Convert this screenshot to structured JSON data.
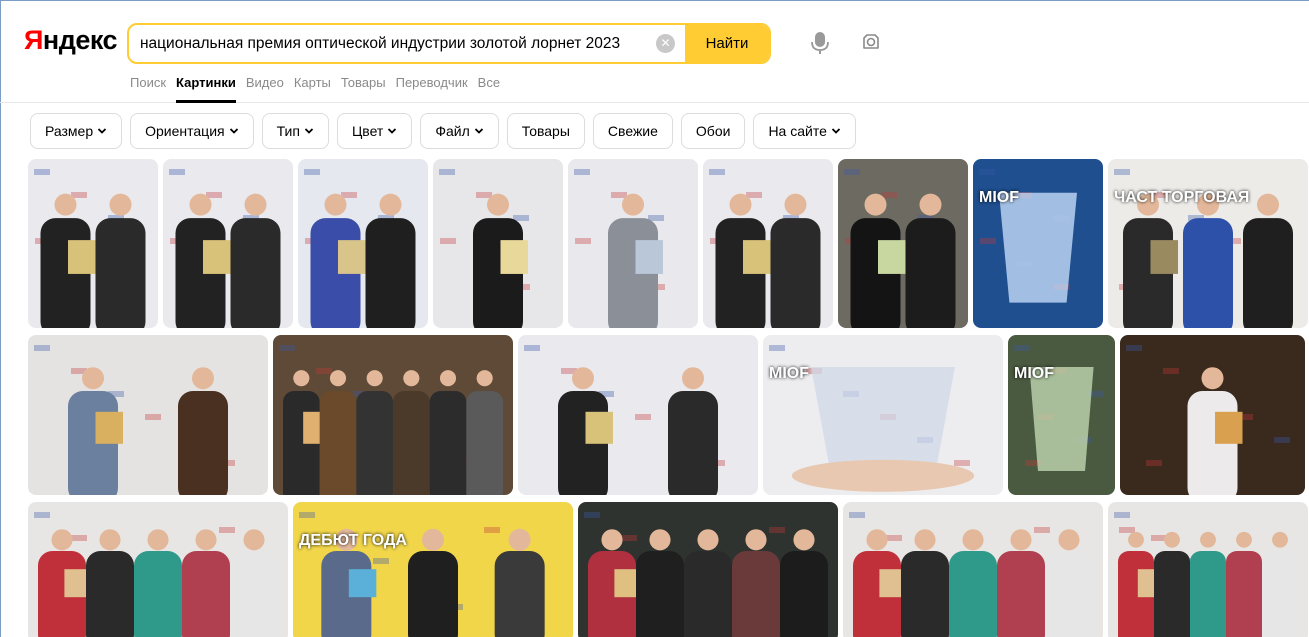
{
  "header": {
    "logo": "Яндекс",
    "search_value": "национальная премия оптической индустрии золотой лорнет 2023",
    "clear_symbol": "✕",
    "search_button": "Найти"
  },
  "services": [
    {
      "label": "Поиск",
      "active": false
    },
    {
      "label": "Картинки",
      "active": true
    },
    {
      "label": "Видео",
      "active": false
    },
    {
      "label": "Карты",
      "active": false
    },
    {
      "label": "Товары",
      "active": false
    },
    {
      "label": "Переводчик",
      "active": false
    },
    {
      "label": "Все",
      "active": false
    }
  ],
  "filters": [
    {
      "label": "Размер",
      "dropdown": true
    },
    {
      "label": "Ориентация",
      "dropdown": true
    },
    {
      "label": "Тип",
      "dropdown": true
    },
    {
      "label": "Цвет",
      "dropdown": true
    },
    {
      "label": "Файл",
      "dropdown": true
    },
    {
      "label": "Товары",
      "dropdown": false
    },
    {
      "label": "Свежие",
      "dropdown": false
    },
    {
      "label": "Обои",
      "dropdown": false
    },
    {
      "label": "На сайте",
      "dropdown": true
    }
  ],
  "colors": {
    "accent_yellow": "#ffcc33",
    "logo_red": "#ff0000",
    "muted_text": "#8a8a8a"
  },
  "image_rows": [
    {
      "images": [
        {
          "id": "r1-1",
          "palette": "award-dark"
        },
        {
          "id": "r1-2",
          "palette": "award-dark"
        },
        {
          "id": "r1-3",
          "palette": "award-blue"
        },
        {
          "id": "r1-4",
          "palette": "award-black"
        },
        {
          "id": "r1-5",
          "palette": "award-grey"
        },
        {
          "id": "r1-6",
          "palette": "award-dark"
        },
        {
          "id": "r1-7",
          "palette": "dark-room"
        },
        {
          "id": "r1-8",
          "palette": "trophy-blue",
          "text": "MIOF"
        },
        {
          "id": "r1-9",
          "palette": "stage-white",
          "text": "ЧАСТ ТОРГОВАЯ"
        }
      ]
    },
    {
      "images": [
        {
          "id": "r2-1",
          "palette": "award-brown"
        },
        {
          "id": "r2-2",
          "palette": "group-warm"
        },
        {
          "id": "r2-3",
          "palette": "award-dark"
        },
        {
          "id": "r2-4",
          "palette": "trophy-hands",
          "text": "MIOF"
        },
        {
          "id": "r2-5",
          "palette": "trophy-green",
          "text": "MIOF"
        },
        {
          "id": "r2-6",
          "palette": "bar-warm"
        }
      ]
    },
    {
      "images": [
        {
          "id": "r3-1",
          "palette": "group-colorful"
        },
        {
          "id": "r3-2",
          "palette": "stage-yellow",
          "text": "ДЕБЮТ ГОДА"
        },
        {
          "id": "r3-3",
          "palette": "group-dark"
        },
        {
          "id": "r3-4",
          "palette": "group-colorful"
        },
        {
          "id": "r3-5",
          "palette": "group-colorful"
        }
      ]
    }
  ]
}
